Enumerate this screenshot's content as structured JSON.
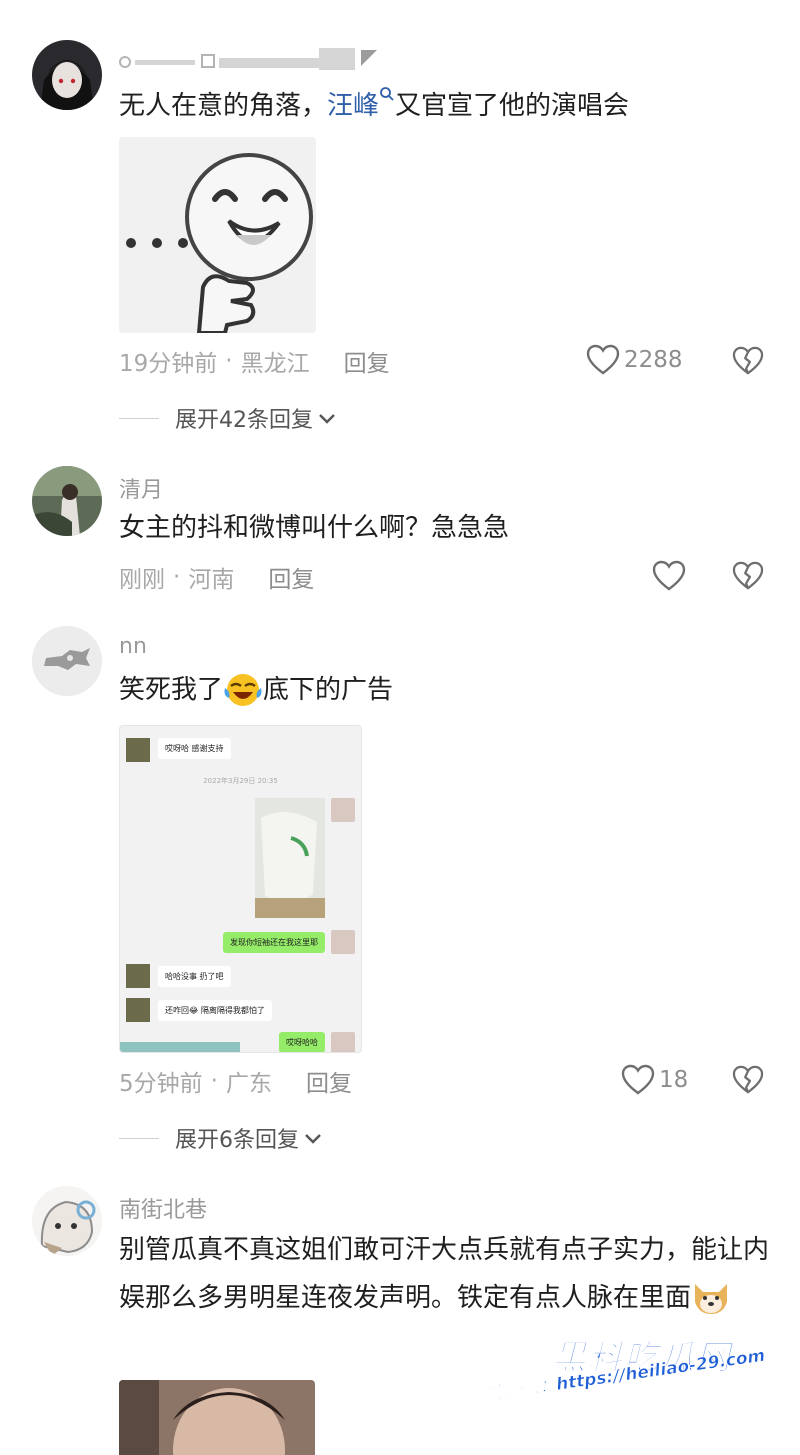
{
  "comments": [
    {
      "username": "",
      "text_prefix": "无人在意的角落，",
      "text_link": "汪峰",
      "text_suffix": "又官宣了他的演唱会",
      "time": "19分钟前",
      "location": "黑龙江",
      "reply": "回复",
      "likes": "2288",
      "expand": "展开42条回复"
    },
    {
      "username": "清月",
      "text": "女主的抖和微博叫什么啊？急急急",
      "time": "刚刚",
      "location": "河南",
      "reply": "回复",
      "likes": ""
    },
    {
      "username": "nn",
      "text_prefix": "笑死我了",
      "text_suffix": "底下的广告",
      "time": "5分钟前",
      "location": "广东",
      "reply": "回复",
      "likes": "18",
      "expand": "展开6条回复"
    },
    {
      "username": "南街北巷",
      "text": "别管瓜真不真这姐们敢可汗大点兵就有点子实力，能让内娱那么多男明星连夜发声明。铁定有点人脉在里面"
    }
  ],
  "chat_screenshot": {
    "msg1": "哎呀哈 感谢支持",
    "timestamp": "2022年3月29日 20:35",
    "msg2": "发现你短袖还在我这里耶",
    "msg3": "哈哈没事 扔了吧",
    "msg4": "还咋回😂 隔离隔得我都怕了",
    "msg5": "哎呀哈哈"
  },
  "watermark": {
    "logo": "黑料吃瓜网",
    "url": "看完整版：https://heiliao-29.com"
  },
  "icons": [
    "heart-icon",
    "broken-heart-icon",
    "chevron-down-icon",
    "search-icon"
  ]
}
